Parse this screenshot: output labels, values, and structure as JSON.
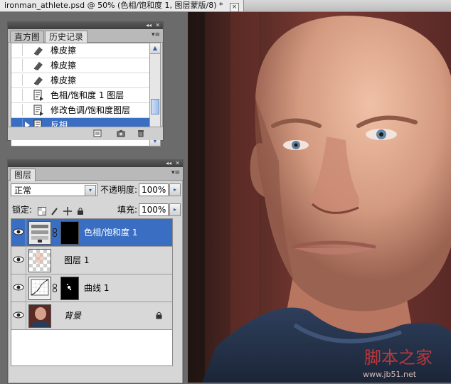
{
  "document": {
    "tab_title": "ironman_athlete.psd @ 50% (色相/饱和度 1, 图层蒙版/8) *",
    "close_glyph": "×"
  },
  "history_panel": {
    "collapse_glyph": "◂◂",
    "close_glyph": "✕",
    "menu_glyph": "▾≡",
    "tabs": [
      "直方图",
      "历史记录"
    ],
    "active_tab": 1,
    "items": [
      {
        "label": "橡皮擦",
        "icon": "eraser-icon"
      },
      {
        "label": "橡皮擦",
        "icon": "eraser-icon"
      },
      {
        "label": "橡皮擦",
        "icon": "eraser-icon"
      },
      {
        "label": "色相/饱和度 1 图层",
        "icon": "adjustment-history-icon"
      },
      {
        "label": "修改色调/饱和度图层",
        "icon": "adjustment-history-icon"
      },
      {
        "label": "反相",
        "icon": "adjustment-history-icon"
      }
    ],
    "selected_index": 5,
    "footer_icons": [
      "new-document-from-state-icon",
      "snapshot-camera-icon",
      "trash-icon"
    ]
  },
  "layers_panel": {
    "collapse_glyph": "◂◂",
    "close_glyph": "✕",
    "menu_glyph": "▾≡",
    "tab": "图层",
    "blend_mode": "正常",
    "opacity_label": "不透明度:",
    "opacity_value": "100%",
    "lock_label": "锁定:",
    "fill_label": "填充:",
    "fill_value": "100%",
    "dropdown_arrow": "▾",
    "field_arrow": "▸",
    "layers": [
      {
        "name": "色相/饱和度 1",
        "type": "adjustment",
        "visible": true
      },
      {
        "name": "图层 1",
        "type": "pixel",
        "visible": true
      },
      {
        "name": "曲线 1",
        "type": "curves",
        "visible": true
      },
      {
        "name": "背景",
        "type": "background",
        "visible": true,
        "locked": true
      }
    ],
    "selected_index": 0
  },
  "colors": {
    "selection": "#3a6ec2",
    "panel_bg": "#d6d6d6",
    "workspace": "#6b6b6b"
  }
}
